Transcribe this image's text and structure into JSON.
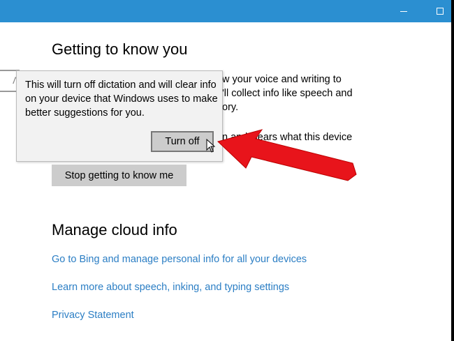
{
  "window": {
    "minimize_icon": "minimize-icon",
    "maximize_icon": "maximize-icon",
    "accent": "#2b8fd1"
  },
  "getting_to_know": {
    "heading": "Getting to know you",
    "desc_fragments": [
      "w your voice and writing to",
      "'ll collect info like speech and",
      "ory.",
      "n and clears what this device"
    ],
    "stop_button": "Stop getting to know me"
  },
  "search": {
    "glyph": "ᐱ"
  },
  "dialog": {
    "message": "This will turn off dictation and will clear info on your device that Windows uses to make better suggestions for you.",
    "turn_off_button": "Turn off"
  },
  "cloud": {
    "heading": "Manage cloud info",
    "links": [
      "Go to Bing and manage personal info for all your devices",
      "Learn more about speech, inking, and typing settings",
      "Privacy Statement"
    ],
    "link_color": "#2b7ec4"
  },
  "annotation": {
    "arrow_color": "#e8141b"
  }
}
